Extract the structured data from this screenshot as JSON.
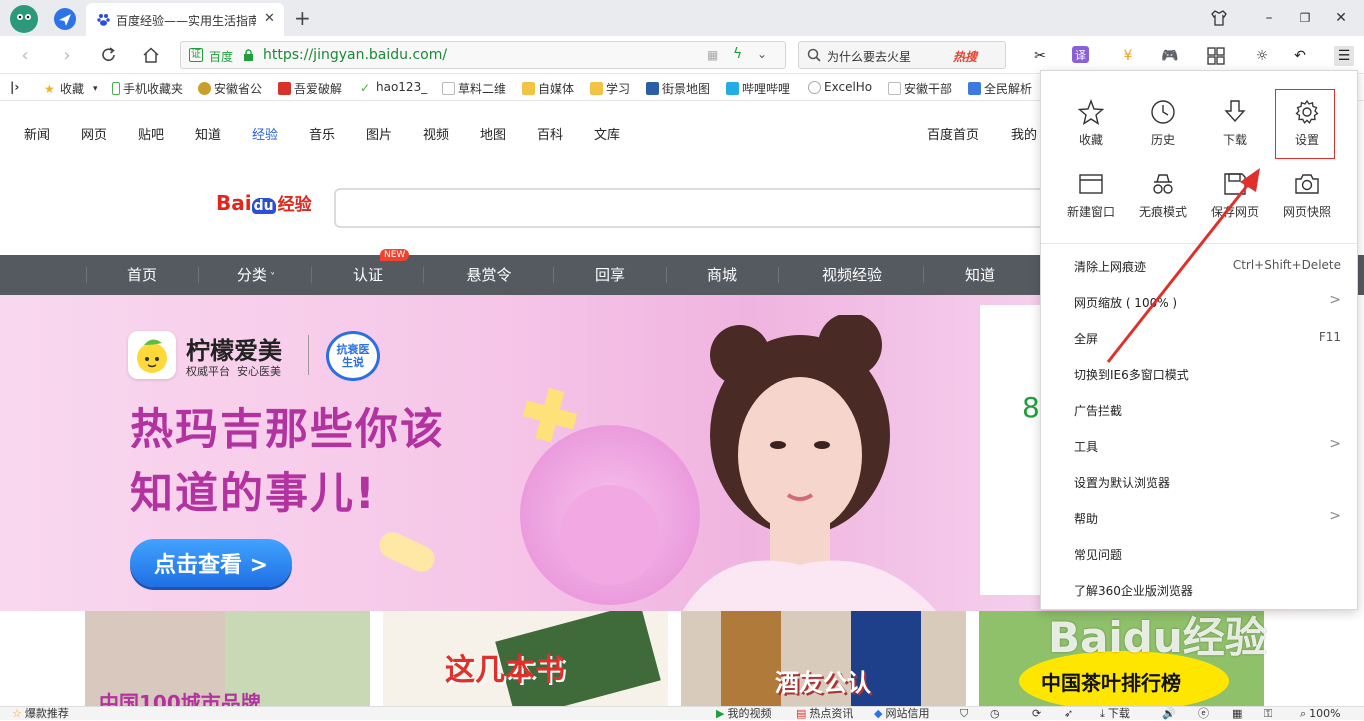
{
  "tab": {
    "title": "百度经验——实用生活指南"
  },
  "window": {
    "minimize": "–",
    "maximize": "❐",
    "close": "✕"
  },
  "address": {
    "site_badge": "证",
    "site_name": "百度",
    "url": "https://jingyan.baidu.com/"
  },
  "search": {
    "placeholder": "为什么要去火星",
    "hot_label": "热搜"
  },
  "toolbar": {
    "translate": "译"
  },
  "bookmarks": [
    {
      "label": "收藏",
      "color": "#f2b21b"
    },
    {
      "label": "手机收藏夹",
      "color": "#4caf50"
    },
    {
      "label": "安徽省公",
      "color": "#c8a02b"
    },
    {
      "label": "吾爱破解",
      "color": "#d9322b"
    },
    {
      "label": "hao123_",
      "color": "#4cae3c"
    },
    {
      "label": "草料二维",
      "color": "#cfcfcf"
    },
    {
      "label": "自媒体",
      "color": "#f3c343"
    },
    {
      "label": "学习",
      "color": "#f3c343"
    },
    {
      "label": "街景地图",
      "color": "#2a5fa8"
    },
    {
      "label": "哔哩哔哩",
      "color": "#23ade5"
    },
    {
      "label": "ExcelHo",
      "color": "#cccccc"
    },
    {
      "label": "安徽干部",
      "color": "#cfcfcf"
    },
    {
      "label": "全民解析",
      "color": "#3b7be0"
    }
  ],
  "top_links": [
    "新闻",
    "网页",
    "贴吧",
    "知道",
    "经验",
    "音乐",
    "图片",
    "视频",
    "地图",
    "百科",
    "文库"
  ],
  "top_right": {
    "home": "百度首页",
    "mine": "我的"
  },
  "logo": {
    "bai": "Bai",
    "du": "du",
    "jingyan": "经验"
  },
  "main_nav": [
    {
      "label": "首页"
    },
    {
      "label": "分类"
    },
    {
      "label": "认证",
      "badge": "NEW"
    },
    {
      "label": "悬赏令"
    },
    {
      "label": "回享"
    },
    {
      "label": "商城"
    },
    {
      "label": "视频经验"
    },
    {
      "label": "知道"
    }
  ],
  "banner": {
    "brand_name": "柠檬爱美",
    "brand_sub": "权威平台  安心医美",
    "partner": "抗衰医生说",
    "line1": "热玛吉那些你该",
    "line2": "知道的事儿!",
    "cta": "点击查看 >",
    "side_digit": "8"
  },
  "cards": [
    {
      "caption": "中国100城市品牌"
    },
    {
      "caption": "这几本书"
    },
    {
      "caption": "酒友公认"
    },
    {
      "caption": "中国茶叶排行榜"
    }
  ],
  "menu": {
    "grid": [
      {
        "label": "收藏",
        "icon": "star-icon"
      },
      {
        "label": "历史",
        "icon": "clock-icon"
      },
      {
        "label": "下载",
        "icon": "download-icon"
      },
      {
        "label": "设置",
        "icon": "gear-icon"
      },
      {
        "label": "新建窗口",
        "icon": "window-icon"
      },
      {
        "label": "无痕模式",
        "icon": "incognito-icon"
      },
      {
        "label": "保存网页",
        "icon": "save-icon"
      },
      {
        "label": "网页快照",
        "icon": "camera-icon"
      }
    ],
    "items": [
      {
        "label": "清除上网痕迹",
        "shortcut": "Ctrl+Shift+Delete"
      },
      {
        "label": "网页缩放 ( 100% )",
        "sub": ">"
      },
      {
        "label": "全屏",
        "shortcut": "F11"
      },
      {
        "label": "切换到IE6多窗口模式"
      },
      {
        "label": "广告拦截"
      },
      {
        "label": "工具",
        "sub": ">"
      },
      {
        "label": "设置为默认浏览器"
      },
      {
        "label": "帮助",
        "sub": ">"
      },
      {
        "label": "常见问题"
      },
      {
        "label": "了解360企业版浏览器"
      }
    ]
  },
  "status": {
    "left": "爆款推荐",
    "video": "我的视频",
    "news": "热点资讯",
    "trust": "网站信用",
    "download": "下载",
    "zoom": "100%"
  },
  "watermark": "Baidu经验",
  "colors": {
    "accent_green": "#1f9f3a",
    "nav_bg": "#555a61",
    "headline": "#b2339f",
    "highlight": "#e0302c"
  }
}
